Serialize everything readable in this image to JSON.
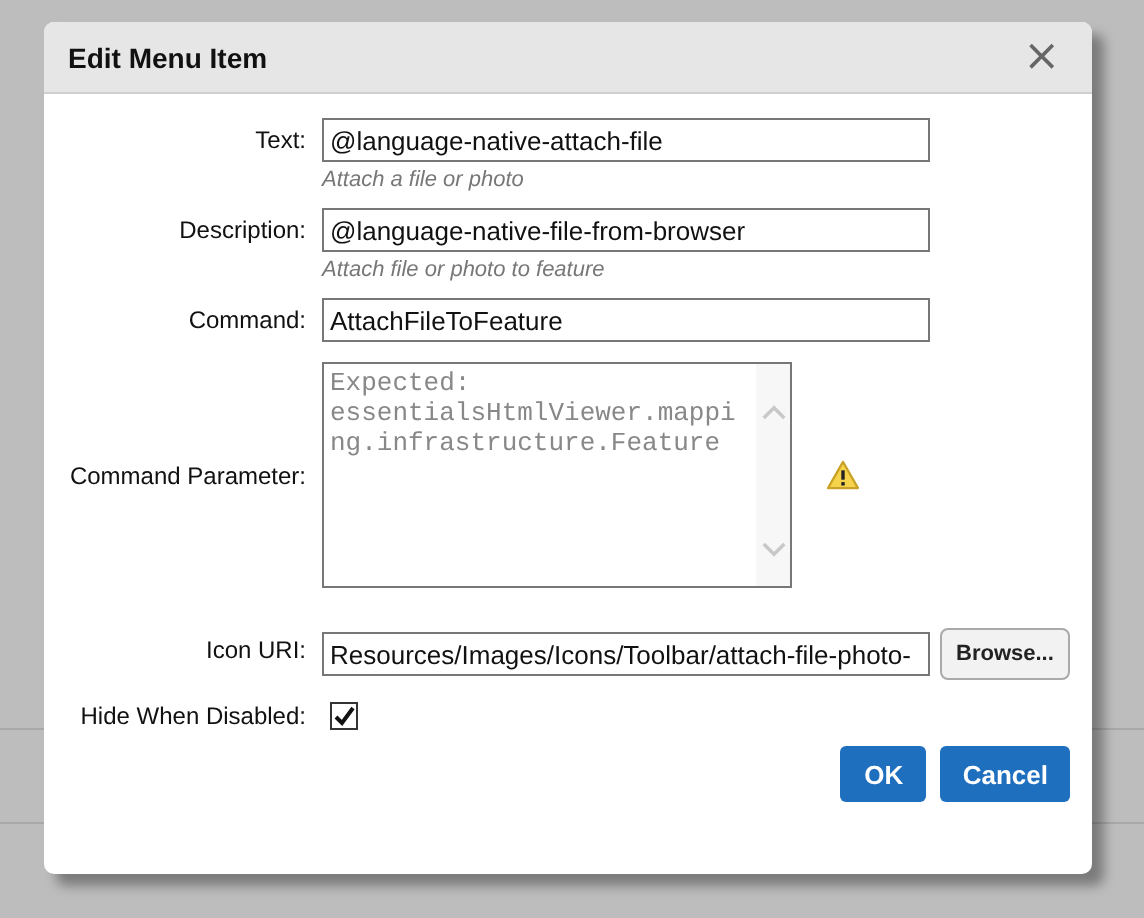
{
  "dialog": {
    "title": "Edit Menu Item",
    "close": "×"
  },
  "fields": [
    {
      "kind": "text",
      "label": "Text:",
      "value": "@language-native-attach-file",
      "hint": "Attach a file or photo"
    },
    {
      "kind": "text",
      "label": "Description:",
      "value": "@language-native-file-from-browser",
      "hint": "Attach file or photo to feature"
    },
    {
      "kind": "text",
      "label": "Command:",
      "value": "AttachFileToFeature"
    },
    {
      "kind": "textarea",
      "label": "Command Parameter:",
      "placeholder": "Expected: essentialsHtmlViewer.mapping.infrastructure.Feature",
      "warning": true
    },
    {
      "kind": "file",
      "label": "Icon URI:",
      "value": "Resources/Images/Icons/Toolbar/attach-file-photo-",
      "button": "Browse..."
    },
    {
      "kind": "checkbox",
      "label": "Hide When Disabled:",
      "checked": true
    }
  ],
  "buttons": [
    "OK",
    "Cancel"
  ]
}
